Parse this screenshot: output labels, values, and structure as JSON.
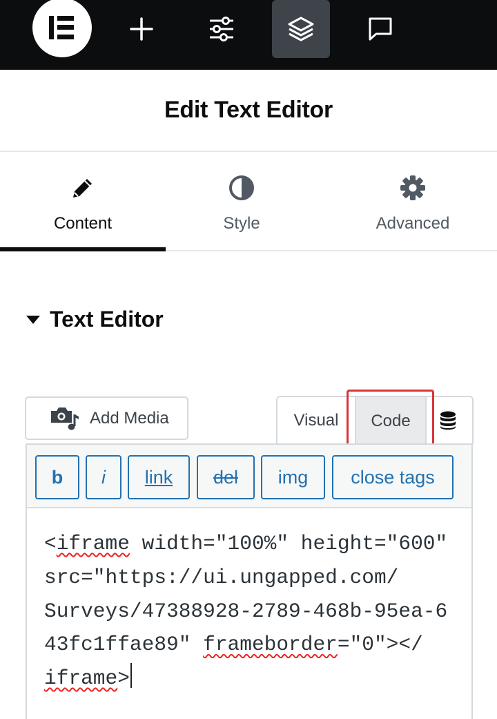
{
  "topbar": {
    "items": [
      {
        "name": "elementor-logo",
        "icon": "elementor-logo-icon"
      },
      {
        "name": "add-element",
        "icon": "plus-icon"
      },
      {
        "name": "site-settings",
        "icon": "sliders-icon"
      },
      {
        "name": "structure",
        "icon": "layers-icon",
        "active": true
      },
      {
        "name": "notes",
        "icon": "comment-icon"
      }
    ]
  },
  "header": {
    "title": "Edit Text Editor"
  },
  "tabs": [
    {
      "label": "Content",
      "icon": "pencil-icon",
      "active": true
    },
    {
      "label": "Style",
      "icon": "half-circle-icon",
      "active": false
    },
    {
      "label": "Advanced",
      "icon": "gear-icon",
      "active": false
    }
  ],
  "section": {
    "title": "Text Editor",
    "expanded": true
  },
  "editor": {
    "add_media_label": "Add Media",
    "mode_tabs": [
      "Visual",
      "Code"
    ],
    "active_mode": "Code",
    "quicktags": [
      "b",
      "i",
      "link",
      "del",
      "img",
      "close tags"
    ],
    "code_lines": [
      [
        "<",
        "iframe",
        " width=\"100%\" height=\"600\""
      ],
      [
        "src=\"https://ui.ungapped.com/"
      ],
      [
        "Surveys/47388928-2789-468b-95ea-6"
      ],
      [
        "43fc1ffae89\" ",
        "frameborder",
        "=\"0\"></"
      ],
      [
        "iframe",
        ">"
      ]
    ]
  },
  "colors": {
    "topbar_bg": "#0c0d0e",
    "accent_blue": "#2271b1",
    "highlight_red": "#d63638"
  }
}
